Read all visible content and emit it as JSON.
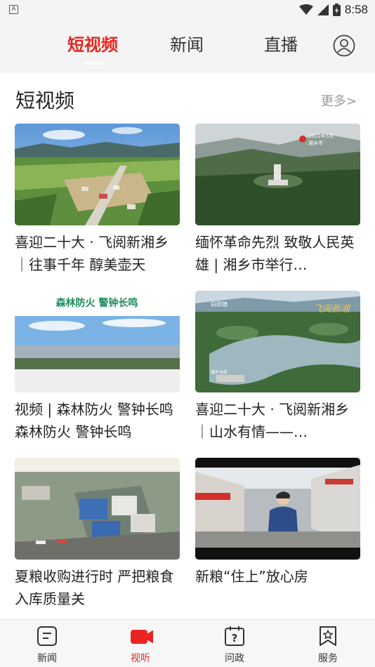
{
  "status_bar": {
    "time": "8:58",
    "notification_icon_letter": "A",
    "icons": [
      "wifi-icon",
      "signal-icon",
      "battery-icon"
    ]
  },
  "top_tabs": [
    {
      "label": "短视频",
      "active": true
    },
    {
      "label": "新闻",
      "active": false
    },
    {
      "label": "直播",
      "active": false
    }
  ],
  "section": {
    "title": "短视频",
    "more_label": "更多>"
  },
  "thumbnail_overlays": {
    "card2_caption_line1": "2022年5月",
    "card2_caption_line2": "湘乡市",
    "card3_banner": "森林防火  警钟长鸣",
    "card4_place1": "白田镇",
    "card4_place2": "湘乡水库",
    "card4_logo": "飞阅新湘"
  },
  "cards": [
    {
      "title": "喜迎二十大 · 飞阅新湘乡｜往事千年 醇美壶天"
    },
    {
      "title": "缅怀革命先烈 致敬人民英雄 | 湘乡市举行…"
    },
    {
      "title": "视频 | 森林防火 警钟长鸣森林防火 警钟长鸣"
    },
    {
      "title": "喜迎二十大 · 飞阅新湘乡｜山水有情——…"
    },
    {
      "title": "夏粮收购进行时 严把粮食入库质量关"
    },
    {
      "title": " 新粮“住上”放心房"
    }
  ],
  "bottom_nav": [
    {
      "label": "新闻",
      "icon": "news-icon",
      "active": false
    },
    {
      "label": "视听",
      "icon": "video-camera-icon",
      "active": true
    },
    {
      "label": "问政",
      "icon": "question-calendar-icon",
      "active": false
    },
    {
      "label": "服务",
      "icon": "star-bookmark-icon",
      "active": false
    }
  ],
  "colors": {
    "accent": "#e8261f",
    "background": "#f4f4f4",
    "content_background": "#ffffff",
    "muted_text": "#9a9a9a"
  }
}
